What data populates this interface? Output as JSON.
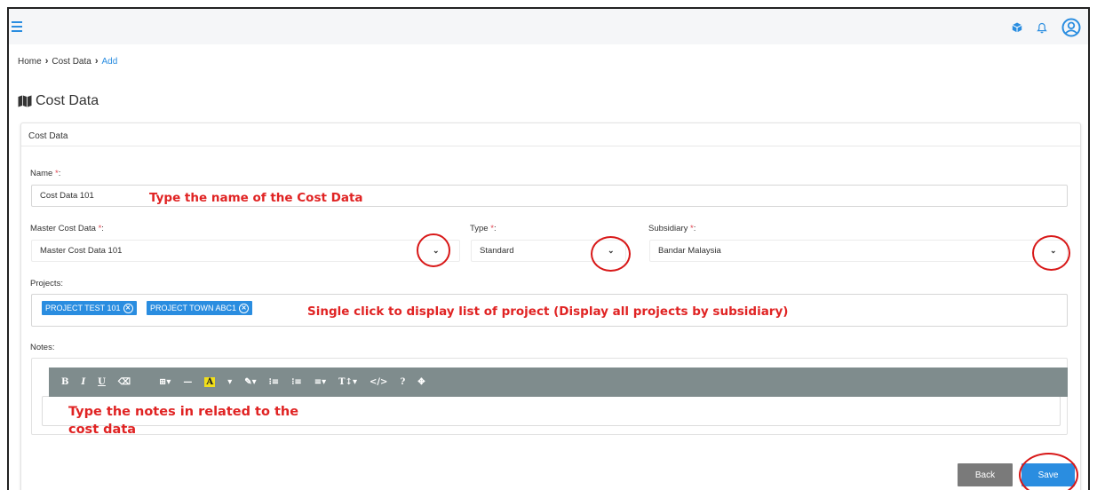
{
  "header": {
    "icons": [
      "menu-icon",
      "cube-icon",
      "bell-icon",
      "user-icon"
    ]
  },
  "breadcrumb": {
    "home": "Home",
    "parent": "Cost Data",
    "current": "Add"
  },
  "page_title": "Cost Data",
  "card_title": "Cost Data",
  "form": {
    "name_label": "Name",
    "name_value": "Cost Data 101",
    "master_label": "Master Cost Data",
    "master_value": "Master Cost Data 101",
    "type_label": "Type",
    "type_value": "Standard",
    "subsidiary_label": "Subsidiary",
    "subsidiary_value": "Bandar Malaysia",
    "projects_label": "Projects:",
    "projects": [
      "PROJECT TEST 101",
      "PROJECT TOWN ABC1"
    ],
    "notes_label": "Notes:",
    "required_marker": "*",
    "colon": ":"
  },
  "toolbar": {
    "bold": "B",
    "italic": "I",
    "underline": "U",
    "eraser": "⌫",
    "table": "⊞▾",
    "hr": "—",
    "color": "A",
    "color_caret": "▾",
    "style": "✎▾",
    "ol": "⁝≡",
    "ul": "⁝≡",
    "align": "≡▾",
    "height": "T↕▾",
    "code": "</>",
    "help": "?",
    "fullscreen": "✥"
  },
  "annotations": {
    "name": "Type the name of the Cost Data",
    "projects": "Single click to display list of project (Display all projects by subsidiary)",
    "notes_line1": "Type the notes in related to the",
    "notes_line2": "cost data"
  },
  "buttons": {
    "back": "Back",
    "save": "Save"
  },
  "colors": {
    "accent": "#2a8de0",
    "annotation": "#e02323",
    "toolbar": "#7f8c8d",
    "back": "#7a7a7a"
  }
}
